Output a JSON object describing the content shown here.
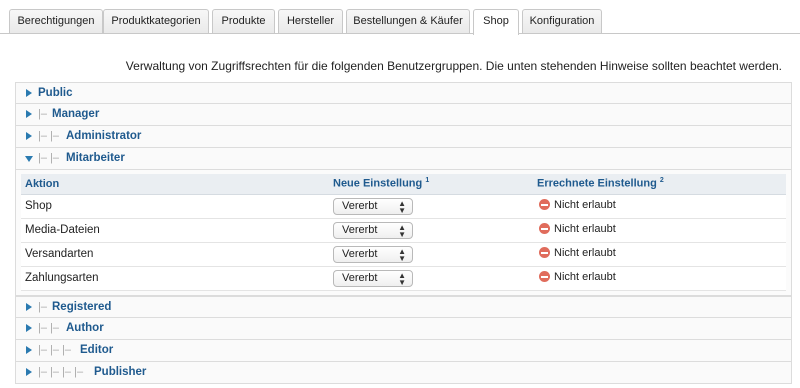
{
  "tabs": [
    {
      "label": "Berechtigungen",
      "active": false
    },
    {
      "label": "Produktkategorien",
      "active": false
    },
    {
      "label": "Produkte",
      "active": false
    },
    {
      "label": "Hersteller",
      "active": false
    },
    {
      "label": "Bestellungen & Käufer",
      "active": false
    },
    {
      "label": "Shop",
      "active": true
    },
    {
      "label": "Konfiguration",
      "active": false
    }
  ],
  "intro": "Verwaltung von Zugriffsrechten für die folgenden Benutzergruppen. Die unten stehenden Hinweise sollten beachtet werden.",
  "groups_before": [
    {
      "prefix": "",
      "name": "Public"
    },
    {
      "prefix": "|– ",
      "name": "Manager"
    },
    {
      "prefix": "|– |– ",
      "name": "Administrator"
    }
  ],
  "expanded_group": {
    "prefix": "|– |– ",
    "name": "Mitarbeiter"
  },
  "table": {
    "headers": {
      "action": "Aktion",
      "new_setting": "Neue Einstellung",
      "new_setting_note": "1",
      "computed": "Errechnete Einstellung",
      "computed_note": "2"
    },
    "rows": [
      {
        "action": "Shop",
        "select": "Vererbt",
        "status": "Nicht erlaubt"
      },
      {
        "action": "Media-Dateien",
        "select": "Vererbt",
        "status": "Nicht erlaubt"
      },
      {
        "action": "Versandarten",
        "select": "Vererbt",
        "status": "Nicht erlaubt"
      },
      {
        "action": "Zahlungsarten",
        "select": "Vererbt",
        "status": "Nicht erlaubt"
      }
    ]
  },
  "groups_after": [
    {
      "prefix": "|– ",
      "name": "Registered"
    },
    {
      "prefix": "|– |– ",
      "name": "Author"
    },
    {
      "prefix": "|– |– |– ",
      "name": "Editor"
    },
    {
      "prefix": "|– |– |– |– ",
      "name": "Publisher"
    }
  ],
  "colors": {
    "link": "#1f5a8e",
    "arrow": "#2a7ab0",
    "deny": "#e06c5c"
  },
  "icons": {
    "collapsed": "triangle-right-icon",
    "expanded": "triangle-down-icon",
    "deny": "deny-circle-icon",
    "select": "updown-caret-icon"
  }
}
